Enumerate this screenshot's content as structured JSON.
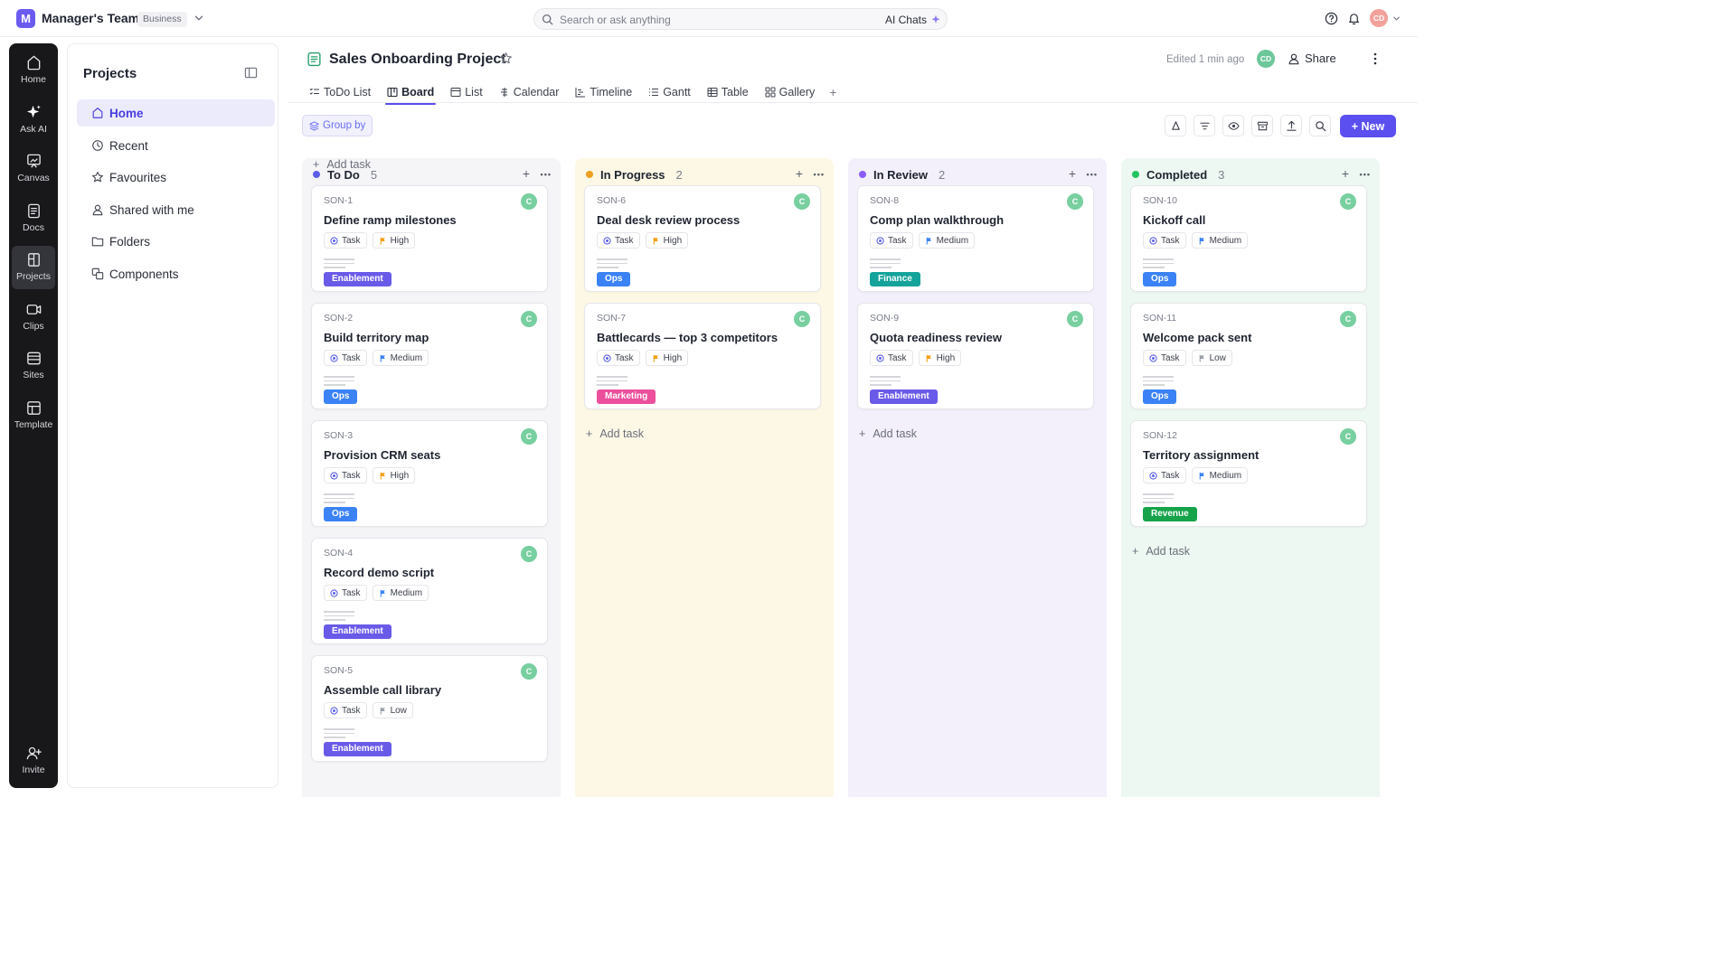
{
  "workspace": {
    "initial": "M",
    "name": "Manager's Team",
    "plan": "Business"
  },
  "search": {
    "placeholder": "Search or ask anything",
    "ai_label": "AI Chats"
  },
  "user": {
    "initials": "CD"
  },
  "rail": [
    {
      "label": "Home",
      "icon": "home-icon"
    },
    {
      "label": "Ask AI",
      "icon": "sparkle-icon"
    },
    {
      "label": "Canvas",
      "icon": "canvas-icon"
    },
    {
      "label": "Docs",
      "icon": "docs-icon"
    },
    {
      "label": "Projects",
      "icon": "projects-icon",
      "active": true
    },
    {
      "label": "Clips",
      "icon": "clips-icon"
    },
    {
      "label": "Sites",
      "icon": "sites-icon"
    },
    {
      "label": "Template",
      "icon": "template-icon"
    },
    {
      "label": "Invite",
      "icon": "invite-icon"
    }
  ],
  "sidebar": {
    "title": "Projects",
    "items": [
      {
        "label": "Home",
        "icon": "home-icon",
        "active": true
      },
      {
        "label": "Recent",
        "icon": "clock-icon"
      },
      {
        "label": "Favourites",
        "icon": "star-icon"
      },
      {
        "label": "Shared with me",
        "icon": "user-icon"
      },
      {
        "label": "Folders",
        "icon": "folder-icon"
      },
      {
        "label": "Components",
        "icon": "components-icon"
      }
    ]
  },
  "page": {
    "title": "Sales Onboarding Project",
    "edited": "Edited 1 min ago",
    "collaborator_initials": "CD",
    "share_label": "Share"
  },
  "tabs": [
    {
      "label": "ToDo List"
    },
    {
      "label": "Board",
      "active": true
    },
    {
      "label": "List"
    },
    {
      "label": "Calendar"
    },
    {
      "label": "Timeline"
    },
    {
      "label": "Gantt"
    },
    {
      "label": "Table"
    },
    {
      "label": "Gallery"
    }
  ],
  "toolbar": {
    "group_by": "Group by",
    "new_label": "+ New"
  },
  "add_task_label": "Add task",
  "colors": {
    "accent": "#5b4ff0",
    "labels": {
      "Enablement": "#6a5ae8",
      "Ops": "#3b82f6",
      "Finance": "#14a39a",
      "Marketing": "#ec4f9c",
      "Revenue": "#16a34a"
    },
    "priority": {
      "High": "#f59e0b",
      "Medium": "#3b82f6",
      "Low": "#9aa0aa"
    }
  },
  "columns": [
    {
      "title": "To Do",
      "count": "5",
      "dot": "#5b5fe8",
      "bg": "#f5f5f8",
      "cards": [
        {
          "id": "SON-1",
          "title": "Define ramp milestones",
          "type": "Task",
          "priority": "High",
          "label": "Enablement",
          "assignee": "C"
        },
        {
          "id": "SON-2",
          "title": "Build territory map",
          "type": "Task",
          "priority": "Medium",
          "label": "Ops",
          "assignee": "C"
        },
        {
          "id": "SON-3",
          "title": "Provision CRM seats",
          "type": "Task",
          "priority": "High",
          "label": "Ops",
          "assignee": "C"
        },
        {
          "id": "SON-4",
          "title": "Record demo script",
          "type": "Task",
          "priority": "Medium",
          "label": "Enablement",
          "assignee": "C"
        },
        {
          "id": "SON-5",
          "title": "Assemble call library",
          "type": "Task",
          "priority": "Low",
          "label": "Enablement",
          "assignee": "C"
        }
      ]
    },
    {
      "title": "In Progress",
      "count": "2",
      "dot": "#f0a020",
      "bg": "#fdf8e6",
      "cards": [
        {
          "id": "SON-6",
          "title": "Deal desk review process",
          "type": "Task",
          "priority": "High",
          "label": "Ops",
          "assignee": "C"
        },
        {
          "id": "SON-7",
          "title": "Battlecards — top 3 competitors",
          "type": "Task",
          "priority": "High",
          "label": "Marketing",
          "assignee": "C"
        }
      ]
    },
    {
      "title": "In Review",
      "count": "2",
      "dot": "#8b5cf6",
      "bg": "#f3f0fb",
      "cards": [
        {
          "id": "SON-8",
          "title": "Comp plan walkthrough",
          "type": "Task",
          "priority": "Medium",
          "label": "Finance",
          "assignee": "C"
        },
        {
          "id": "SON-9",
          "title": "Quota readiness review",
          "type": "Task",
          "priority": "High",
          "label": "Enablement",
          "assignee": "C"
        }
      ]
    },
    {
      "title": "Completed",
      "count": "3",
      "dot": "#22c55e",
      "bg": "#eef8f2",
      "cards": [
        {
          "id": "SON-10",
          "title": "Kickoff call",
          "type": "Task",
          "priority": "Medium",
          "label": "Ops",
          "assignee": "C"
        },
        {
          "id": "SON-11",
          "title": "Welcome pack sent",
          "type": "Task",
          "priority": "Low",
          "label": "Ops",
          "assignee": "C"
        },
        {
          "id": "SON-12",
          "title": "Territory assignment",
          "type": "Task",
          "priority": "Medium",
          "label": "Revenue",
          "assignee": "C"
        }
      ]
    }
  ]
}
